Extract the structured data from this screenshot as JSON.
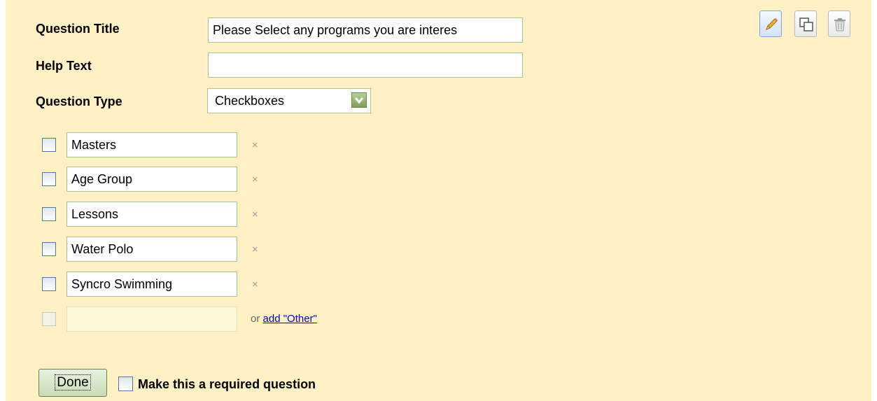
{
  "question": {
    "title_label": "Question Title",
    "title_value": "Please Select any programs you are interes",
    "help_label": "Help Text",
    "help_value": "",
    "type_label": "Question Type",
    "type_value": "Checkboxes"
  },
  "options": [
    {
      "label": "Masters",
      "remove": "×"
    },
    {
      "label": "Age Group",
      "remove": "×"
    },
    {
      "label": "Lessons",
      "remove": "×"
    },
    {
      "label": "Water Polo",
      "remove": "×"
    },
    {
      "label": "Syncro Swimming",
      "remove": "×"
    }
  ],
  "new_option": {
    "value": "",
    "or_text": "or",
    "add_other_link": "add \"Other\""
  },
  "toolbar": {
    "edit_icon": "pencil-icon",
    "duplicate_icon": "duplicate-icon",
    "delete_icon": "trash-icon"
  },
  "footer": {
    "done_label": "Done",
    "required_label": "Make this a required question",
    "required_checked": false
  },
  "colors": {
    "panel_background": "#fff1c5",
    "input_border": "#a9bf8d",
    "link": "#0000cc"
  }
}
